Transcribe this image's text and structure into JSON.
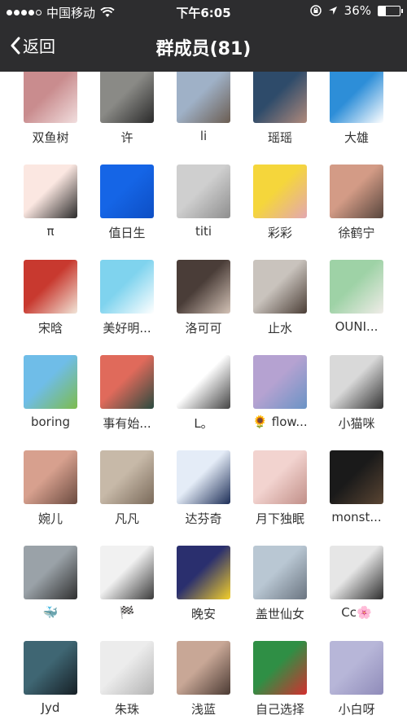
{
  "status_bar": {
    "carrier": "中国移动",
    "time": "下午6:05",
    "battery": "36%",
    "battery_level": 0.36,
    "icons": [
      "signal-dots-icon",
      "wifi-icon",
      "rotation-lock-icon",
      "location-arrow-icon",
      "battery-icon"
    ]
  },
  "nav": {
    "back_label": "返回",
    "title": "群成员(81)",
    "back_icon": "chevron-left-icon"
  },
  "members": [
    {
      "name": "双鱼树",
      "colors": [
        "#c98c8e",
        "#f1dede"
      ]
    },
    {
      "name": "许",
      "colors": [
        "#8a8a86",
        "#2a2a2a"
      ]
    },
    {
      "name": "li",
      "colors": [
        "#9fb1c7",
        "#6b5d52"
      ]
    },
    {
      "name": "瑶瑶",
      "colors": [
        "#2e4b6a",
        "#b08a7c"
      ]
    },
    {
      "name": "大雄",
      "colors": [
        "#2d8ed8",
        "#ffffff"
      ]
    },
    {
      "name": "π",
      "colors": [
        "#fbe7e1",
        "#2a2a2a"
      ]
    },
    {
      "name": "值日生",
      "colors": [
        "#1565e6",
        "#0d4ec4"
      ]
    },
    {
      "name": "titi",
      "colors": [
        "#cfcfcf",
        "#8e8e8e"
      ]
    },
    {
      "name": "彩彩",
      "colors": [
        "#f5d63b",
        "#e3a7b1"
      ]
    },
    {
      "name": "徐鹤宁",
      "colors": [
        "#d39b86",
        "#57453c"
      ]
    },
    {
      "name": "宋晗",
      "colors": [
        "#c8392f",
        "#f1e5d8"
      ]
    },
    {
      "name": "美好明...",
      "colors": [
        "#7fd3ee",
        "#ffffff"
      ]
    },
    {
      "name": "洛可可",
      "colors": [
        "#4a3d38",
        "#d3c2b6"
      ]
    },
    {
      "name": "止水",
      "colors": [
        "#c9c3bd",
        "#4b3e36"
      ]
    },
    {
      "name": "OUNI...",
      "colors": [
        "#9ed2a6",
        "#f0ece8"
      ]
    },
    {
      "name": "boring",
      "colors": [
        "#6fbde8",
        "#7dbb4d"
      ]
    },
    {
      "name": "事有始...",
      "colors": [
        "#e06a5b",
        "#2a4a3f"
      ]
    },
    {
      "name": "L。",
      "colors": [
        "#ffffff",
        "#444444"
      ]
    },
    {
      "name": "🌻 flow...",
      "colors": [
        "#b5a2d1",
        "#6a93c5"
      ]
    },
    {
      "name": "小猫咪",
      "colors": [
        "#d9d9d9",
        "#333333"
      ]
    },
    {
      "name": "婉儿",
      "colors": [
        "#d7a08e",
        "#6b4b40"
      ]
    },
    {
      "name": "凡凡",
      "colors": [
        "#c7b9a8",
        "#7a6a5a"
      ]
    },
    {
      "name": "达芬奇",
      "colors": [
        "#e4ecf7",
        "#1d2e57"
      ]
    },
    {
      "name": "月下独眠",
      "colors": [
        "#f2d3cf",
        "#c18f88"
      ]
    },
    {
      "name": "monst...",
      "colors": [
        "#1a1a1a",
        "#5a4533"
      ]
    },
    {
      "name": "🐳",
      "colors": [
        "#9aa2a8",
        "#2f2f2f"
      ]
    },
    {
      "name": "🏁",
      "colors": [
        "#f1f1f1",
        "#3a3a3a"
      ]
    },
    {
      "name": "晚安",
      "colors": [
        "#2a2f6e",
        "#f3cf2a"
      ]
    },
    {
      "name": "盖世仙女",
      "colors": [
        "#b9c7d3",
        "#6a7480"
      ]
    },
    {
      "name": "Cc🌸",
      "colors": [
        "#e6e6e6",
        "#2d2d2d"
      ]
    },
    {
      "name": "Jyd",
      "colors": [
        "#3f6673",
        "#161f25"
      ]
    },
    {
      "name": "朱珠",
      "colors": [
        "#ececec",
        "#b3b3b3"
      ]
    },
    {
      "name": "浅蓝",
      "colors": [
        "#c8a796",
        "#4b3a33"
      ]
    },
    {
      "name": "自己选择",
      "colors": [
        "#2f8f45",
        "#d32f2f"
      ]
    },
    {
      "name": "小白呀",
      "colors": [
        "#b7b6d8",
        "#8f8bb9"
      ]
    }
  ]
}
